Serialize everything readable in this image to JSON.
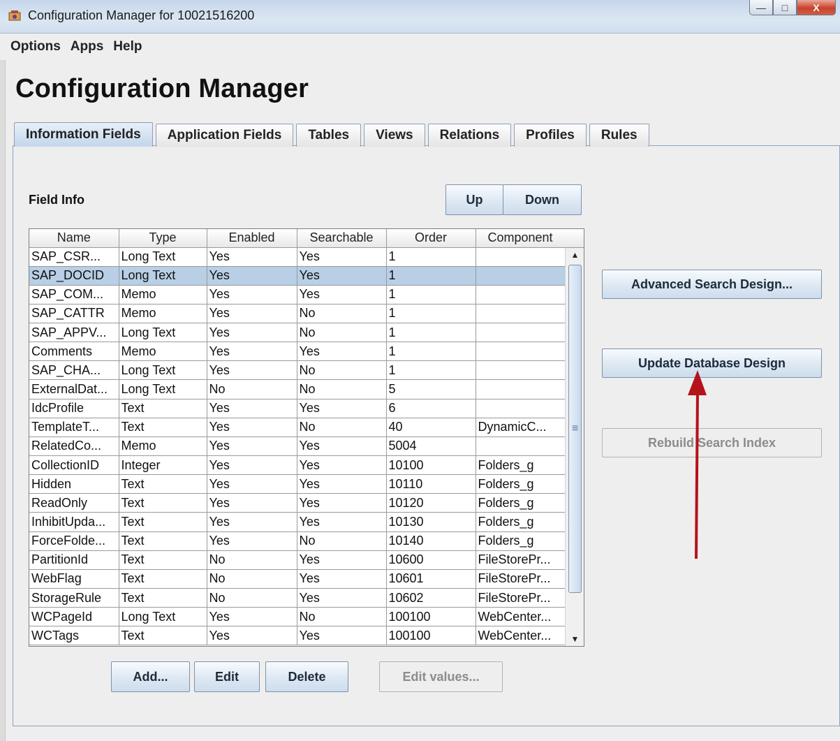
{
  "window": {
    "title": "Configuration Manager for 10021516200",
    "controls": {
      "minimize": "—",
      "maximize": "□",
      "close": "X"
    }
  },
  "menu": [
    "Options",
    "Apps",
    "Help"
  ],
  "page_title": "Configuration Manager",
  "tabs": [
    {
      "label": "Information Fields",
      "active": true
    },
    {
      "label": "Application Fields",
      "active": false
    },
    {
      "label": "Tables",
      "active": false
    },
    {
      "label": "Views",
      "active": false
    },
    {
      "label": "Relations",
      "active": false
    },
    {
      "label": "Profiles",
      "active": false
    },
    {
      "label": "Rules",
      "active": false
    }
  ],
  "field_info": {
    "label": "Field Info",
    "up_label": "Up",
    "down_label": "Down",
    "columns": [
      "Name",
      "Type",
      "Enabled",
      "Searchable",
      "Order",
      "Component"
    ],
    "rows": [
      [
        "SAP_CSR...",
        "Long Text",
        "Yes",
        "Yes",
        "1",
        ""
      ],
      [
        "SAP_DOCID",
        "Long Text",
        "Yes",
        "Yes",
        "1",
        ""
      ],
      [
        "SAP_COM...",
        "Memo",
        "Yes",
        "Yes",
        "1",
        ""
      ],
      [
        "SAP_CATTR",
        "Memo",
        "Yes",
        "No",
        "1",
        ""
      ],
      [
        "SAP_APPV...",
        "Long Text",
        "Yes",
        "No",
        "1",
        ""
      ],
      [
        "Comments",
        "Memo",
        "Yes",
        "Yes",
        "1",
        ""
      ],
      [
        "SAP_CHA...",
        "Long Text",
        "Yes",
        "No",
        "1",
        ""
      ],
      [
        "ExternalDat...",
        "Long Text",
        "No",
        "No",
        "5",
        ""
      ],
      [
        "IdcProfile",
        "Text",
        "Yes",
        "Yes",
        "6",
        ""
      ],
      [
        "TemplateT...",
        "Text",
        "Yes",
        "No",
        "40",
        "DynamicC..."
      ],
      [
        "RelatedCo...",
        "Memo",
        "Yes",
        "Yes",
        "5004",
        ""
      ],
      [
        "CollectionID",
        "Integer",
        "Yes",
        "Yes",
        "10100",
        "Folders_g"
      ],
      [
        "Hidden",
        "Text",
        "Yes",
        "Yes",
        "10110",
        "Folders_g"
      ],
      [
        "ReadOnly",
        "Text",
        "Yes",
        "Yes",
        "10120",
        "Folders_g"
      ],
      [
        "InhibitUpda...",
        "Text",
        "Yes",
        "Yes",
        "10130",
        "Folders_g"
      ],
      [
        "ForceFolde...",
        "Text",
        "Yes",
        "No",
        "10140",
        "Folders_g"
      ],
      [
        "PartitionId",
        "Text",
        "No",
        "Yes",
        "10600",
        "FileStorePr..."
      ],
      [
        "WebFlag",
        "Text",
        "No",
        "Yes",
        "10601",
        "FileStorePr..."
      ],
      [
        "StorageRule",
        "Text",
        "No",
        "Yes",
        "10602",
        "FileStorePr..."
      ],
      [
        "WCPageId",
        "Long Text",
        "Yes",
        "No",
        "100100",
        "WebCenter..."
      ],
      [
        "WCTags",
        "Text",
        "Yes",
        "Yes",
        "100100",
        "WebCenter..."
      ]
    ],
    "selected_row": 1,
    "add_label": "Add...",
    "edit_label": "Edit",
    "delete_label": "Delete",
    "edit_values_label": "Edit values..."
  },
  "side_buttons": {
    "advanced_search": "Advanced Search Design...",
    "update_database": "Update Database Design",
    "rebuild_index": "Rebuild Search Index"
  },
  "annotation_color": "#b5121b"
}
